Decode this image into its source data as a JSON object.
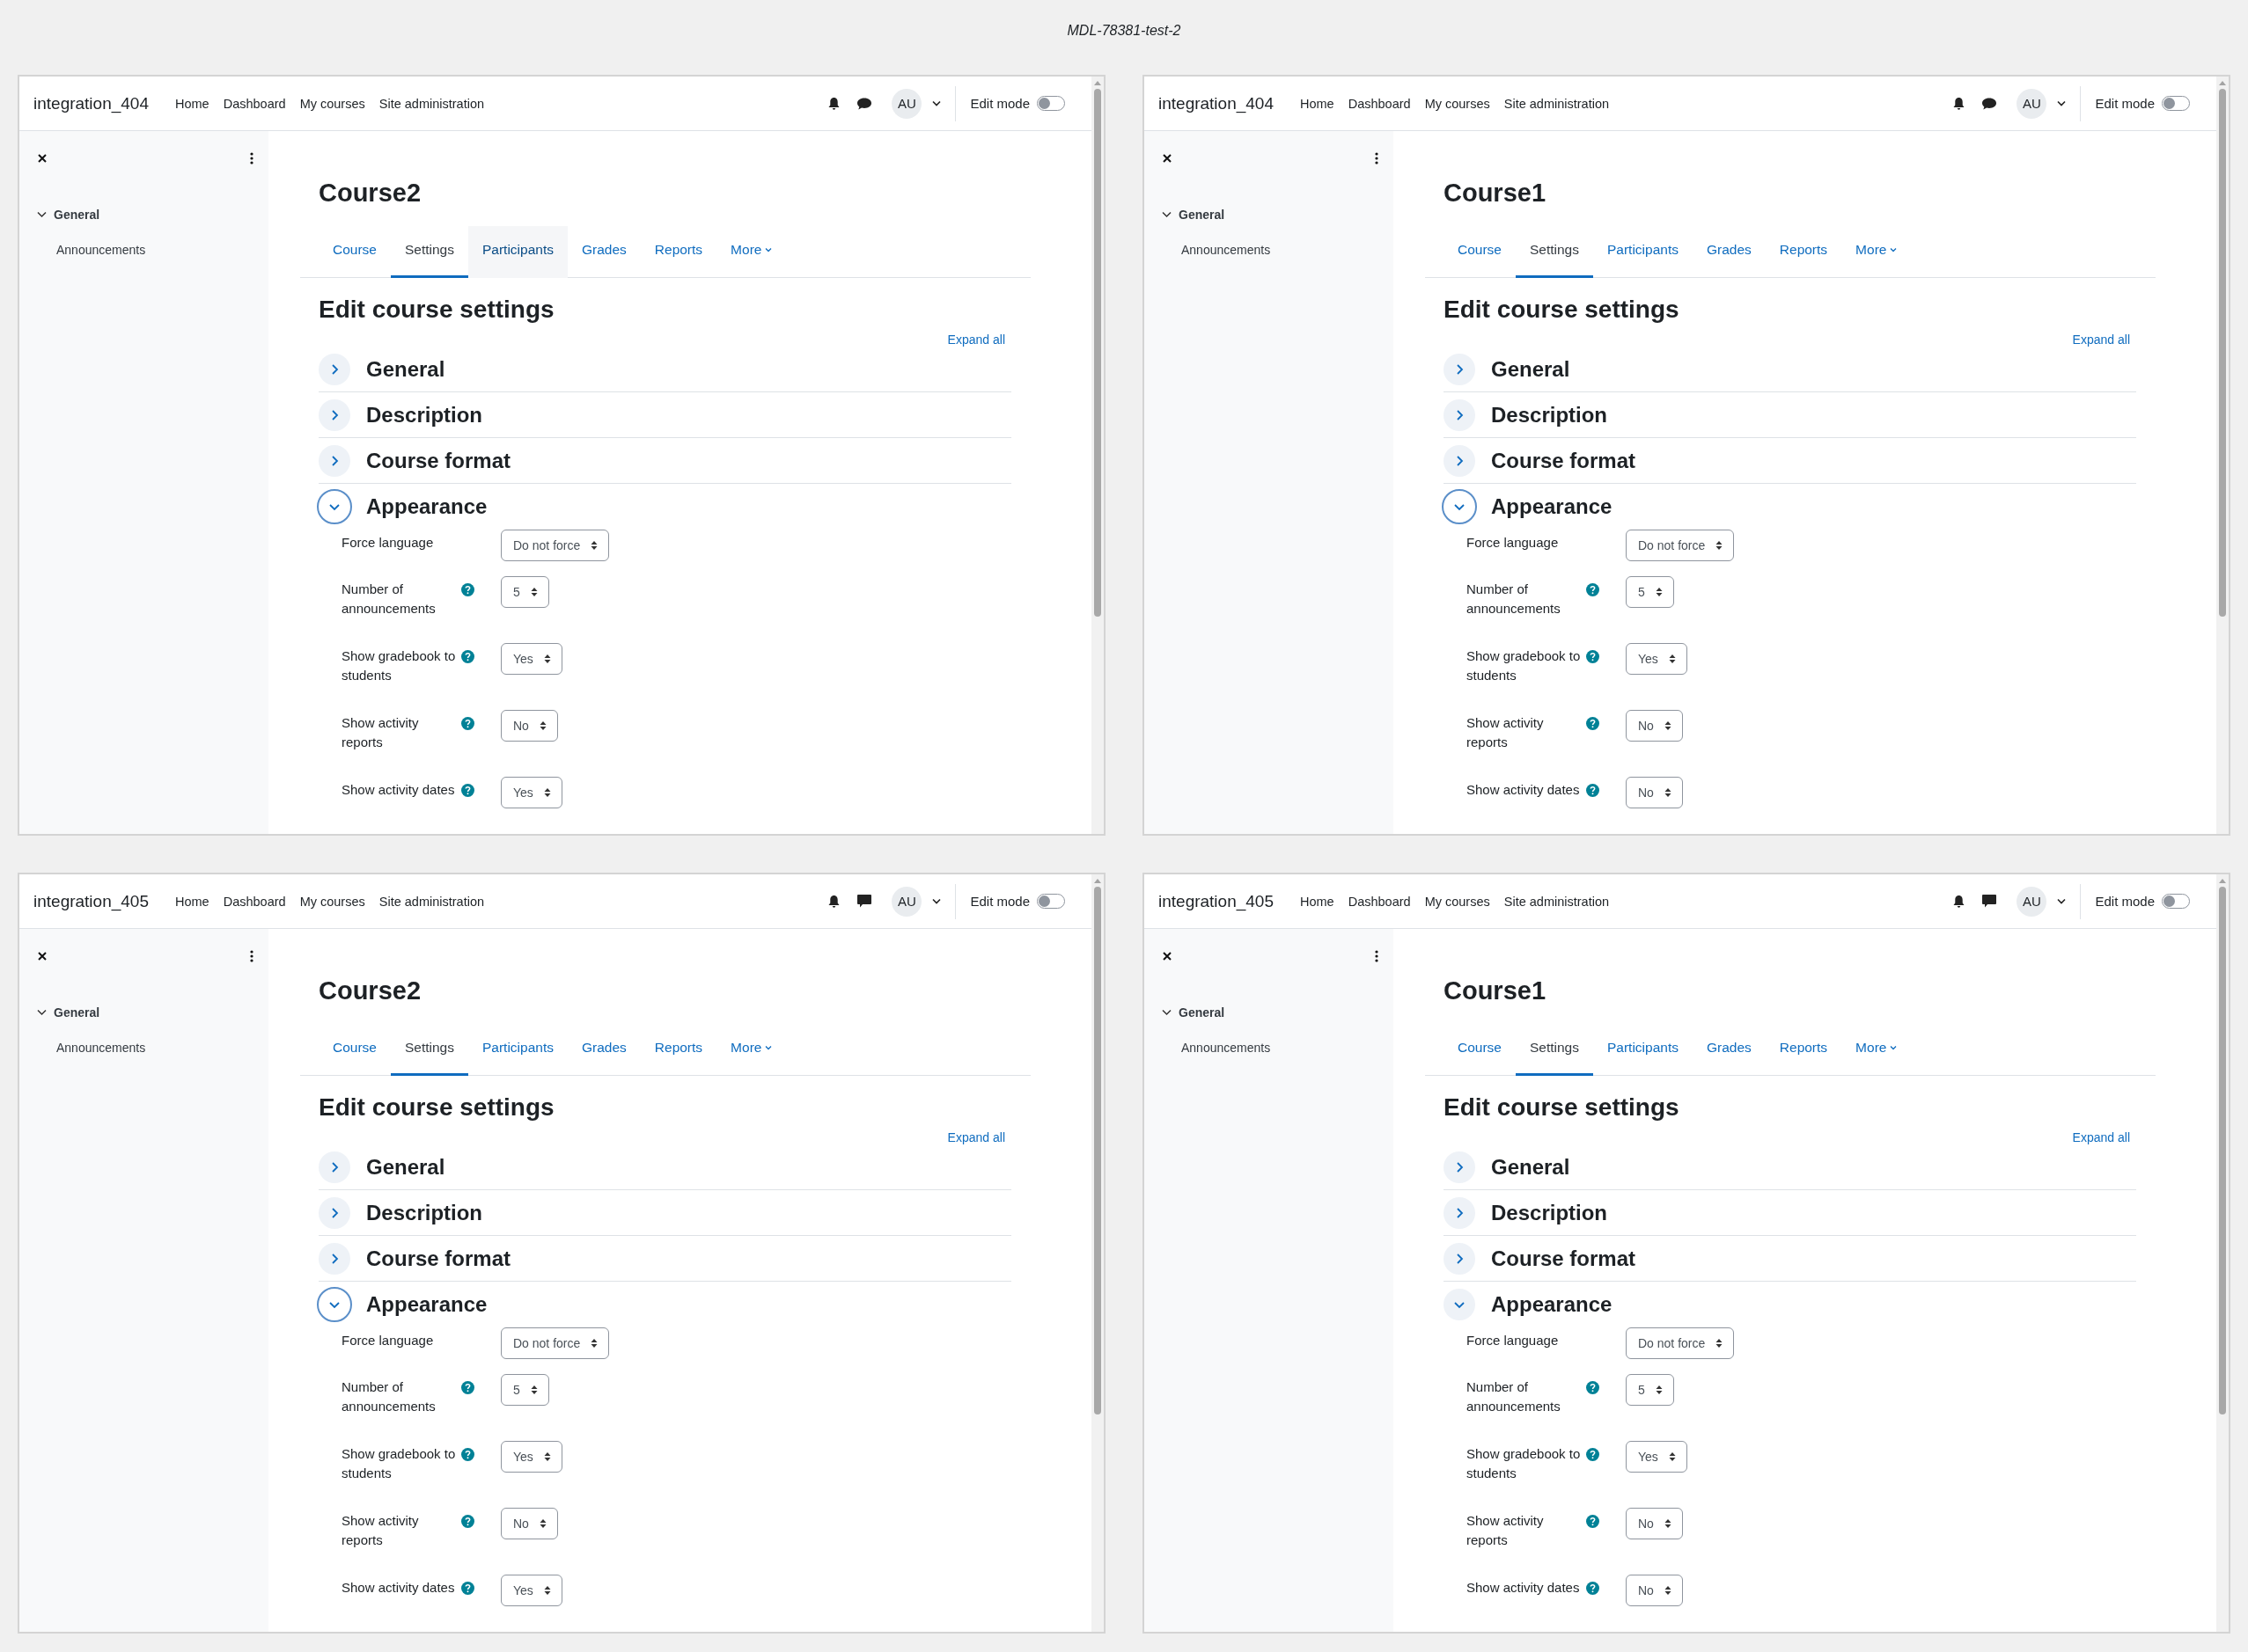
{
  "page_title": "MDL-78381-test-2",
  "panels": [
    {
      "site_name": "integration_404",
      "nav": [
        "Home",
        "Dashboard",
        "My courses",
        "Site administration"
      ],
      "messages": {
        "kind": "bubble"
      },
      "avatar": "AU",
      "edit_mode": {
        "label": "Edit mode",
        "on": false
      },
      "drawer": {
        "section": {
          "label": "General",
          "expanded": true
        },
        "items": [
          "Announcements"
        ]
      },
      "course_title": "Course2",
      "tabs": [
        {
          "label": "Course",
          "kind": "link",
          "selected": false,
          "hovered": false
        },
        {
          "label": "Settings",
          "kind": "link",
          "selected": true,
          "hovered": false
        },
        {
          "label": "Participants",
          "kind": "link",
          "selected": false,
          "hovered": true
        },
        {
          "label": "Grades",
          "kind": "link",
          "selected": false,
          "hovered": false
        },
        {
          "label": "Reports",
          "kind": "link",
          "selected": false,
          "hovered": false
        },
        {
          "label": "More",
          "kind": "dropdown",
          "selected": false,
          "hovered": false
        }
      ],
      "heading": "Edit course settings",
      "expand_all": "Expand all",
      "sections": [
        {
          "label": "General",
          "expanded": false,
          "focused": false
        },
        {
          "label": "Description",
          "expanded": false,
          "focused": false
        },
        {
          "label": "Course format",
          "expanded": false,
          "focused": false
        },
        {
          "label": "Appearance",
          "expanded": true,
          "focused": true,
          "fields": [
            {
              "label": "Force language",
              "help": false,
              "value": "Do not force"
            },
            {
              "label": "Number of announcements",
              "help": true,
              "value": "5"
            },
            {
              "label": "Show gradebook to students",
              "help": true,
              "value": "Yes"
            },
            {
              "label": "Show activity reports",
              "help": true,
              "value": "No"
            },
            {
              "label": "Show activity dates",
              "help": true,
              "value": "Yes"
            }
          ]
        }
      ]
    },
    {
      "site_name": "integration_404",
      "nav": [
        "Home",
        "Dashboard",
        "My courses",
        "Site administration"
      ],
      "messages": {
        "kind": "bubble"
      },
      "avatar": "AU",
      "edit_mode": {
        "label": "Edit mode",
        "on": false
      },
      "drawer": {
        "section": {
          "label": "General",
          "expanded": true
        },
        "items": [
          "Announcements"
        ]
      },
      "course_title": "Course1",
      "tabs": [
        {
          "label": "Course",
          "kind": "link",
          "selected": false,
          "hovered": false
        },
        {
          "label": "Settings",
          "kind": "link",
          "selected": true,
          "hovered": false
        },
        {
          "label": "Participants",
          "kind": "link",
          "selected": false,
          "hovered": false
        },
        {
          "label": "Grades",
          "kind": "link",
          "selected": false,
          "hovered": false
        },
        {
          "label": "Reports",
          "kind": "link",
          "selected": false,
          "hovered": false
        },
        {
          "label": "More",
          "kind": "dropdown",
          "selected": false,
          "hovered": false
        }
      ],
      "heading": "Edit course settings",
      "expand_all": "Expand all",
      "sections": [
        {
          "label": "General",
          "expanded": false,
          "focused": false
        },
        {
          "label": "Description",
          "expanded": false,
          "focused": false
        },
        {
          "label": "Course format",
          "expanded": false,
          "focused": false
        },
        {
          "label": "Appearance",
          "expanded": true,
          "focused": true,
          "fields": [
            {
              "label": "Force language",
              "help": false,
              "value": "Do not force"
            },
            {
              "label": "Number of announcements",
              "help": true,
              "value": "5"
            },
            {
              "label": "Show gradebook to students",
              "help": true,
              "value": "Yes"
            },
            {
              "label": "Show activity reports",
              "help": true,
              "value": "No"
            },
            {
              "label": "Show activity dates",
              "help": true,
              "value": "No"
            }
          ]
        }
      ]
    },
    {
      "site_name": "integration_405",
      "nav": [
        "Home",
        "Dashboard",
        "My courses",
        "Site administration"
      ],
      "messages": {
        "kind": "square"
      },
      "avatar": "AU",
      "edit_mode": {
        "label": "Edit mode",
        "on": false
      },
      "drawer": {
        "section": {
          "label": "General",
          "expanded": true
        },
        "items": [
          "Announcements"
        ]
      },
      "course_title": "Course2",
      "tabs": [
        {
          "label": "Course",
          "kind": "link",
          "selected": false,
          "hovered": false
        },
        {
          "label": "Settings",
          "kind": "link",
          "selected": true,
          "hovered": false
        },
        {
          "label": "Participants",
          "kind": "link",
          "selected": false,
          "hovered": false
        },
        {
          "label": "Grades",
          "kind": "link",
          "selected": false,
          "hovered": false
        },
        {
          "label": "Reports",
          "kind": "link",
          "selected": false,
          "hovered": false
        },
        {
          "label": "More",
          "kind": "dropdown",
          "selected": false,
          "hovered": false
        }
      ],
      "heading": "Edit course settings",
      "expand_all": "Expand all",
      "sections": [
        {
          "label": "General",
          "expanded": false,
          "focused": false
        },
        {
          "label": "Description",
          "expanded": false,
          "focused": false
        },
        {
          "label": "Course format",
          "expanded": false,
          "focused": false
        },
        {
          "label": "Appearance",
          "expanded": true,
          "focused": true,
          "fields": [
            {
              "label": "Force language",
              "help": false,
              "value": "Do not force"
            },
            {
              "label": "Number of announcements",
              "help": true,
              "value": "5"
            },
            {
              "label": "Show gradebook to students",
              "help": true,
              "value": "Yes"
            },
            {
              "label": "Show activity reports",
              "help": true,
              "value": "No"
            },
            {
              "label": "Show activity dates",
              "help": true,
              "value": "Yes"
            }
          ]
        }
      ]
    },
    {
      "site_name": "integration_405",
      "nav": [
        "Home",
        "Dashboard",
        "My courses",
        "Site administration"
      ],
      "messages": {
        "kind": "square"
      },
      "avatar": "AU",
      "edit_mode": {
        "label": "Edit mode",
        "on": false
      },
      "drawer": {
        "section": {
          "label": "General",
          "expanded": true
        },
        "items": [
          "Announcements"
        ]
      },
      "course_title": "Course1",
      "tabs": [
        {
          "label": "Course",
          "kind": "link",
          "selected": false,
          "hovered": false
        },
        {
          "label": "Settings",
          "kind": "link",
          "selected": true,
          "hovered": false
        },
        {
          "label": "Participants",
          "kind": "link",
          "selected": false,
          "hovered": false
        },
        {
          "label": "Grades",
          "kind": "link",
          "selected": false,
          "hovered": false
        },
        {
          "label": "Reports",
          "kind": "link",
          "selected": false,
          "hovered": false
        },
        {
          "label": "More",
          "kind": "dropdown",
          "selected": false,
          "hovered": false
        }
      ],
      "heading": "Edit course settings",
      "expand_all": "Expand all",
      "sections": [
        {
          "label": "General",
          "expanded": false,
          "focused": false
        },
        {
          "label": "Description",
          "expanded": false,
          "focused": false
        },
        {
          "label": "Course format",
          "expanded": false,
          "focused": false
        },
        {
          "label": "Appearance",
          "expanded": true,
          "focused": false,
          "fields": [
            {
              "label": "Force language",
              "help": false,
              "value": "Do not force"
            },
            {
              "label": "Number of announcements",
              "help": true,
              "value": "5"
            },
            {
              "label": "Show gradebook to students",
              "help": true,
              "value": "Yes"
            },
            {
              "label": "Show activity reports",
              "help": true,
              "value": "No"
            },
            {
              "label": "Show activity dates",
              "help": true,
              "value": "No"
            }
          ]
        }
      ]
    }
  ]
}
